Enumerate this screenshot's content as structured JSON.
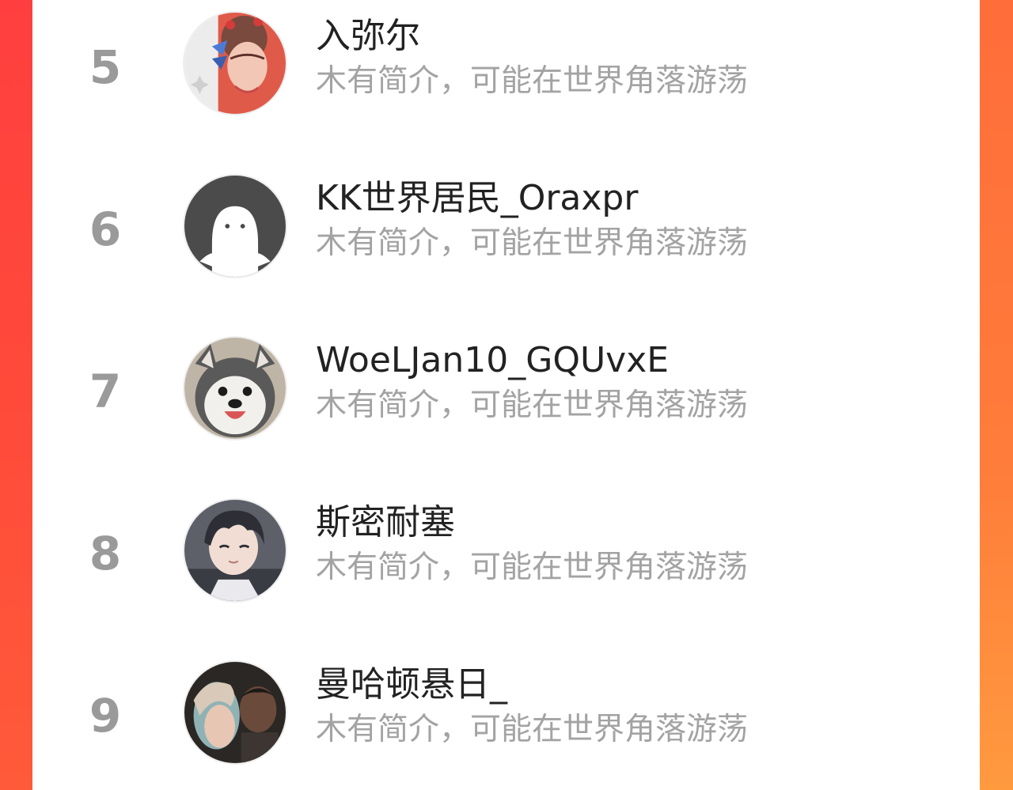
{
  "ranking_list": {
    "items": [
      {
        "rank": "5",
        "name": "入弥尔",
        "bio": "木有简介，可能在世界角落游荡",
        "avatar_icon": "illustrated-girl-butterfly-avatar"
      },
      {
        "rank": "6",
        "name": "KK世界居民_Oraxpr",
        "bio": "木有简介，可能在世界角落游荡",
        "avatar_icon": "default-ghost-avatar"
      },
      {
        "rank": "7",
        "name": "WoeLJan10_GQUvxE",
        "bio": "木有简介，可能在世界角落游荡",
        "avatar_icon": "husky-dog-avatar"
      },
      {
        "rank": "8",
        "name": "斯密耐塞",
        "bio": "木有简介，可能在世界角落游荡",
        "avatar_icon": "anime-boy-avatar"
      },
      {
        "rank": "9",
        "name": "曼哈顿悬日_",
        "bio": "木有简介，可能在世界角落游荡",
        "avatar_icon": "photo-couple-avatar"
      }
    ]
  },
  "colors": {
    "rank_text": "#9a9a9a",
    "name_text": "#222222",
    "bio_text": "#a3a3a3",
    "background_accent": "#ff5a3a"
  }
}
